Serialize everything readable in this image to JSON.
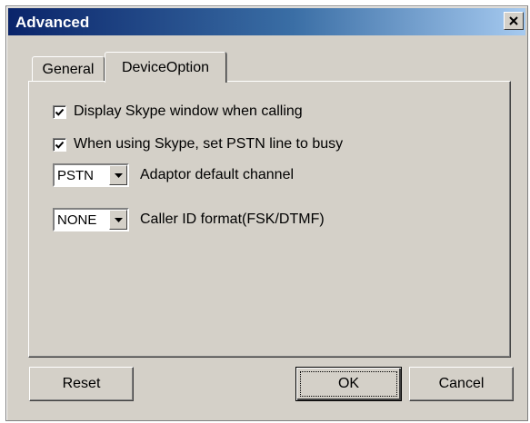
{
  "window": {
    "title": "Advanced"
  },
  "tabs": [
    {
      "label": "General",
      "selected": false
    },
    {
      "label": "DeviceOption",
      "selected": true
    }
  ],
  "options": {
    "display_skype_window": {
      "label": "Display Skype window when calling",
      "checked": true
    },
    "set_pstn_busy": {
      "label": "When using Skype, set PSTN line to busy",
      "checked": true
    }
  },
  "adaptor_channel": {
    "value": "PSTN",
    "label": "Adaptor default channel"
  },
  "caller_id_format": {
    "value": "NONE",
    "label": "Caller ID format(FSK/DTMF)"
  },
  "buttons": {
    "reset": "Reset",
    "ok": "OK",
    "cancel": "Cancel"
  },
  "icons": {
    "close": "close-icon",
    "check": "checkmark-icon",
    "dropdown": "triangle-down-icon"
  }
}
